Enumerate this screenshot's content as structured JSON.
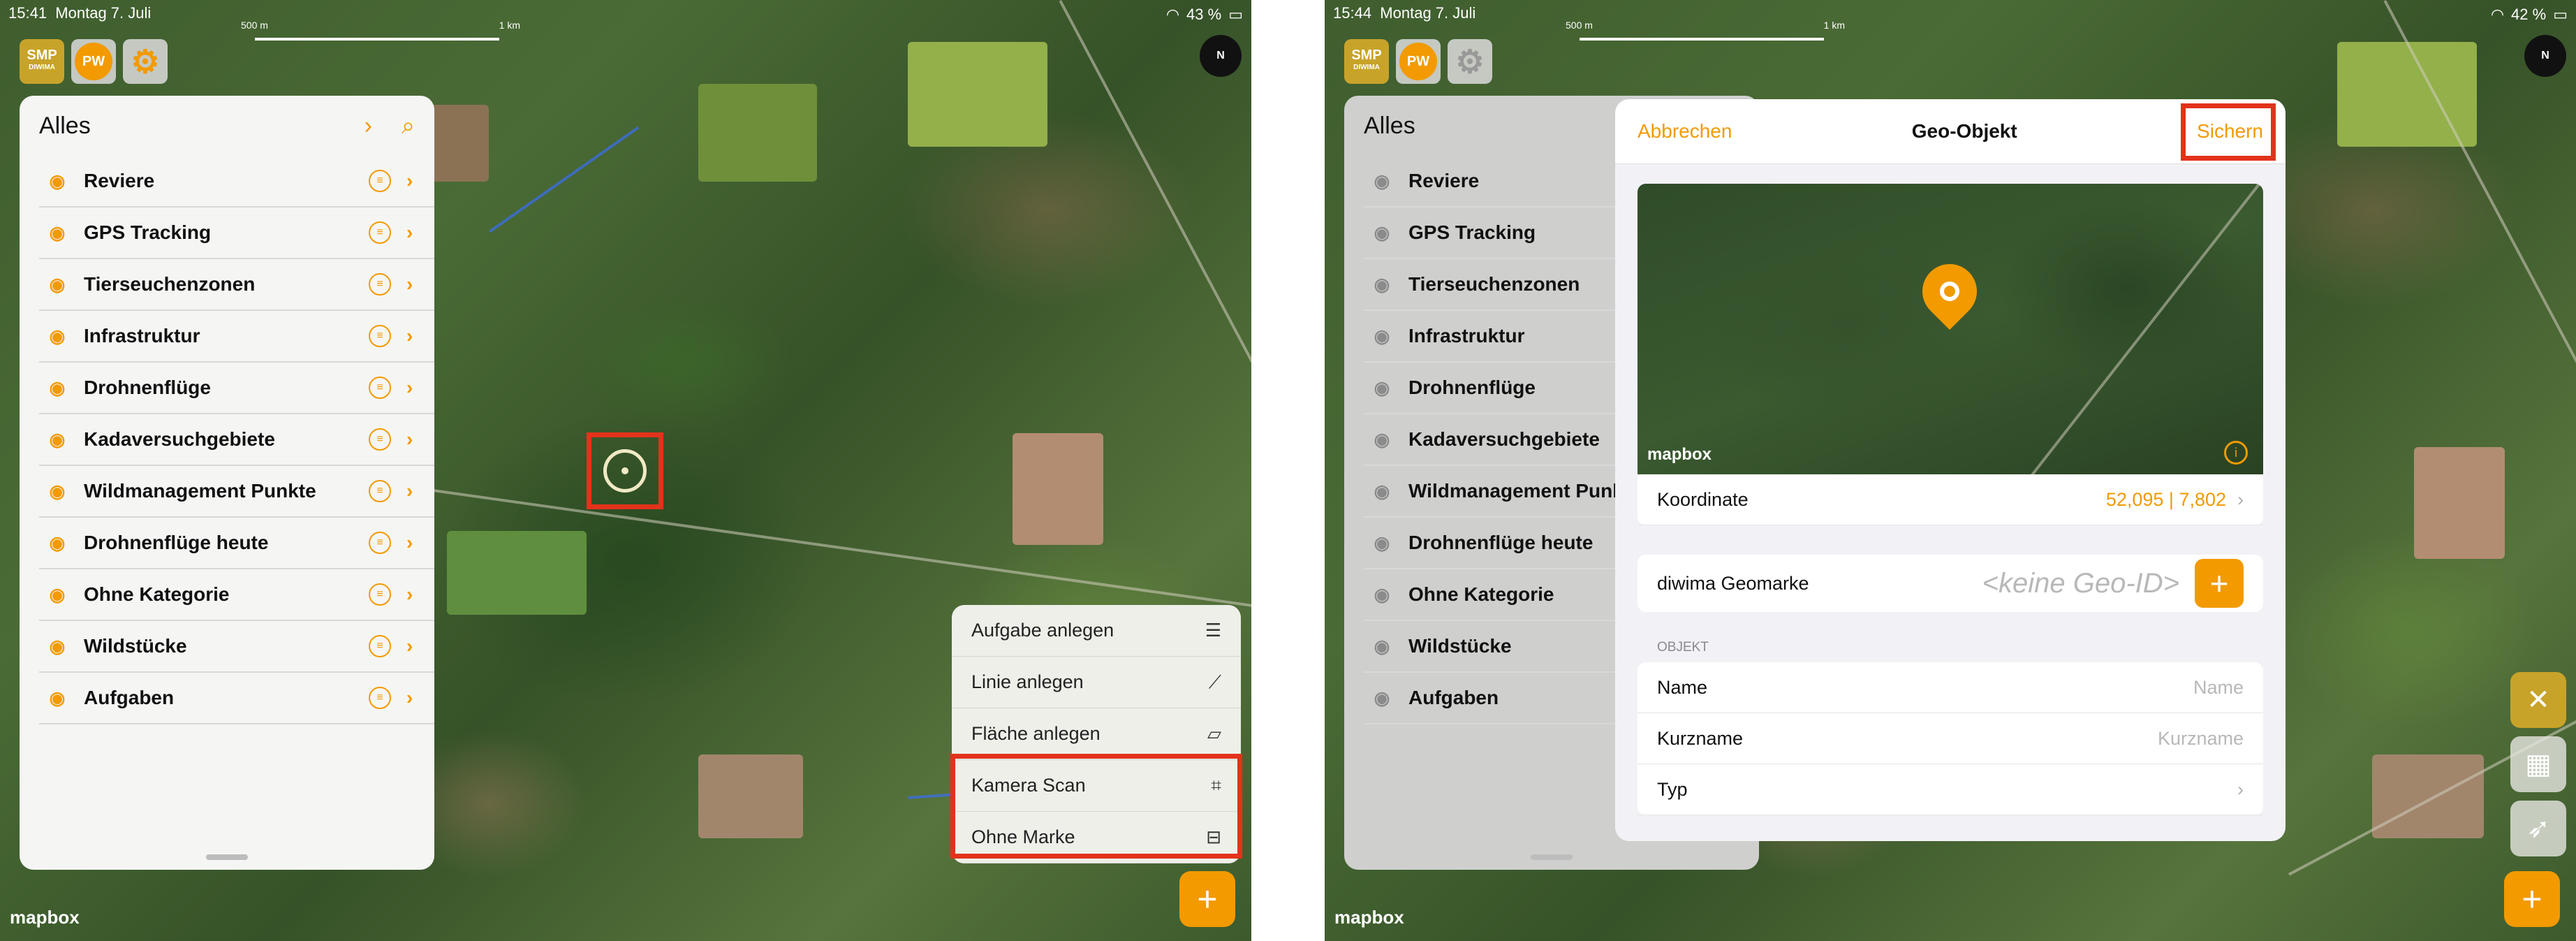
{
  "left_screen": {
    "status": {
      "time": "15:41",
      "date": "Montag 7. Juli",
      "battery": "43 %"
    },
    "scale": {
      "start": "500 m",
      "end": "1 km"
    },
    "compass_label": "N",
    "top_icons": {
      "smp_label": "SMP",
      "smp_sub": "DIWIMA",
      "user_initials": "PW"
    },
    "panel": {
      "title": "Alles",
      "items": [
        {
          "label": "Reviere"
        },
        {
          "label": "GPS Tracking"
        },
        {
          "label": "Tierseuchenzonen"
        },
        {
          "label": "Infrastruktur"
        },
        {
          "label": "Drohnenflüge"
        },
        {
          "label": "Kadaversuchgebiete"
        },
        {
          "label": "Wildmanagement Punkte"
        },
        {
          "label": "Drohnenflüge heute"
        },
        {
          "label": "Ohne Kategorie"
        },
        {
          "label": "Wildstücke"
        },
        {
          "label": "Aufgaben"
        }
      ]
    },
    "menu": {
      "items": [
        {
          "label": "Aufgabe anlegen",
          "icon": "task-list-icon"
        },
        {
          "label": "Linie anlegen",
          "icon": "line-icon"
        },
        {
          "label": "Fläche anlegen",
          "icon": "polygon-icon"
        },
        {
          "label": "Kamera Scan",
          "icon": "camera-scan-icon"
        },
        {
          "label": "Ohne Marke",
          "icon": "no-mark-icon"
        }
      ]
    },
    "map_attribution": "mapbox"
  },
  "right_screen": {
    "status": {
      "time": "15:44",
      "date": "Montag 7. Juli",
      "battery": "42 %"
    },
    "scale": {
      "start": "500 m",
      "end": "1 km"
    },
    "compass_label": "N",
    "panel_title": "Alles",
    "sheet": {
      "cancel_label": "Abbrechen",
      "title": "Geo-Objekt",
      "save_label": "Sichern",
      "map_attribution": "mapbox",
      "coordinate": {
        "label": "Koordinate",
        "value": "52,095 | 7,802"
      },
      "geomark": {
        "label": "diwima Geomarke",
        "placeholder": "<keine Geo-ID>"
      },
      "section_label": "OBJEKT",
      "fields": [
        {
          "label": "Name",
          "placeholder": "Name"
        },
        {
          "label": "Kurzname",
          "placeholder": "Kurzname"
        },
        {
          "label": "Typ",
          "placeholder": ""
        }
      ]
    },
    "map_attribution": "mapbox"
  },
  "colors": {
    "accent": "#f29a00",
    "highlight_box": "#e3321b"
  }
}
